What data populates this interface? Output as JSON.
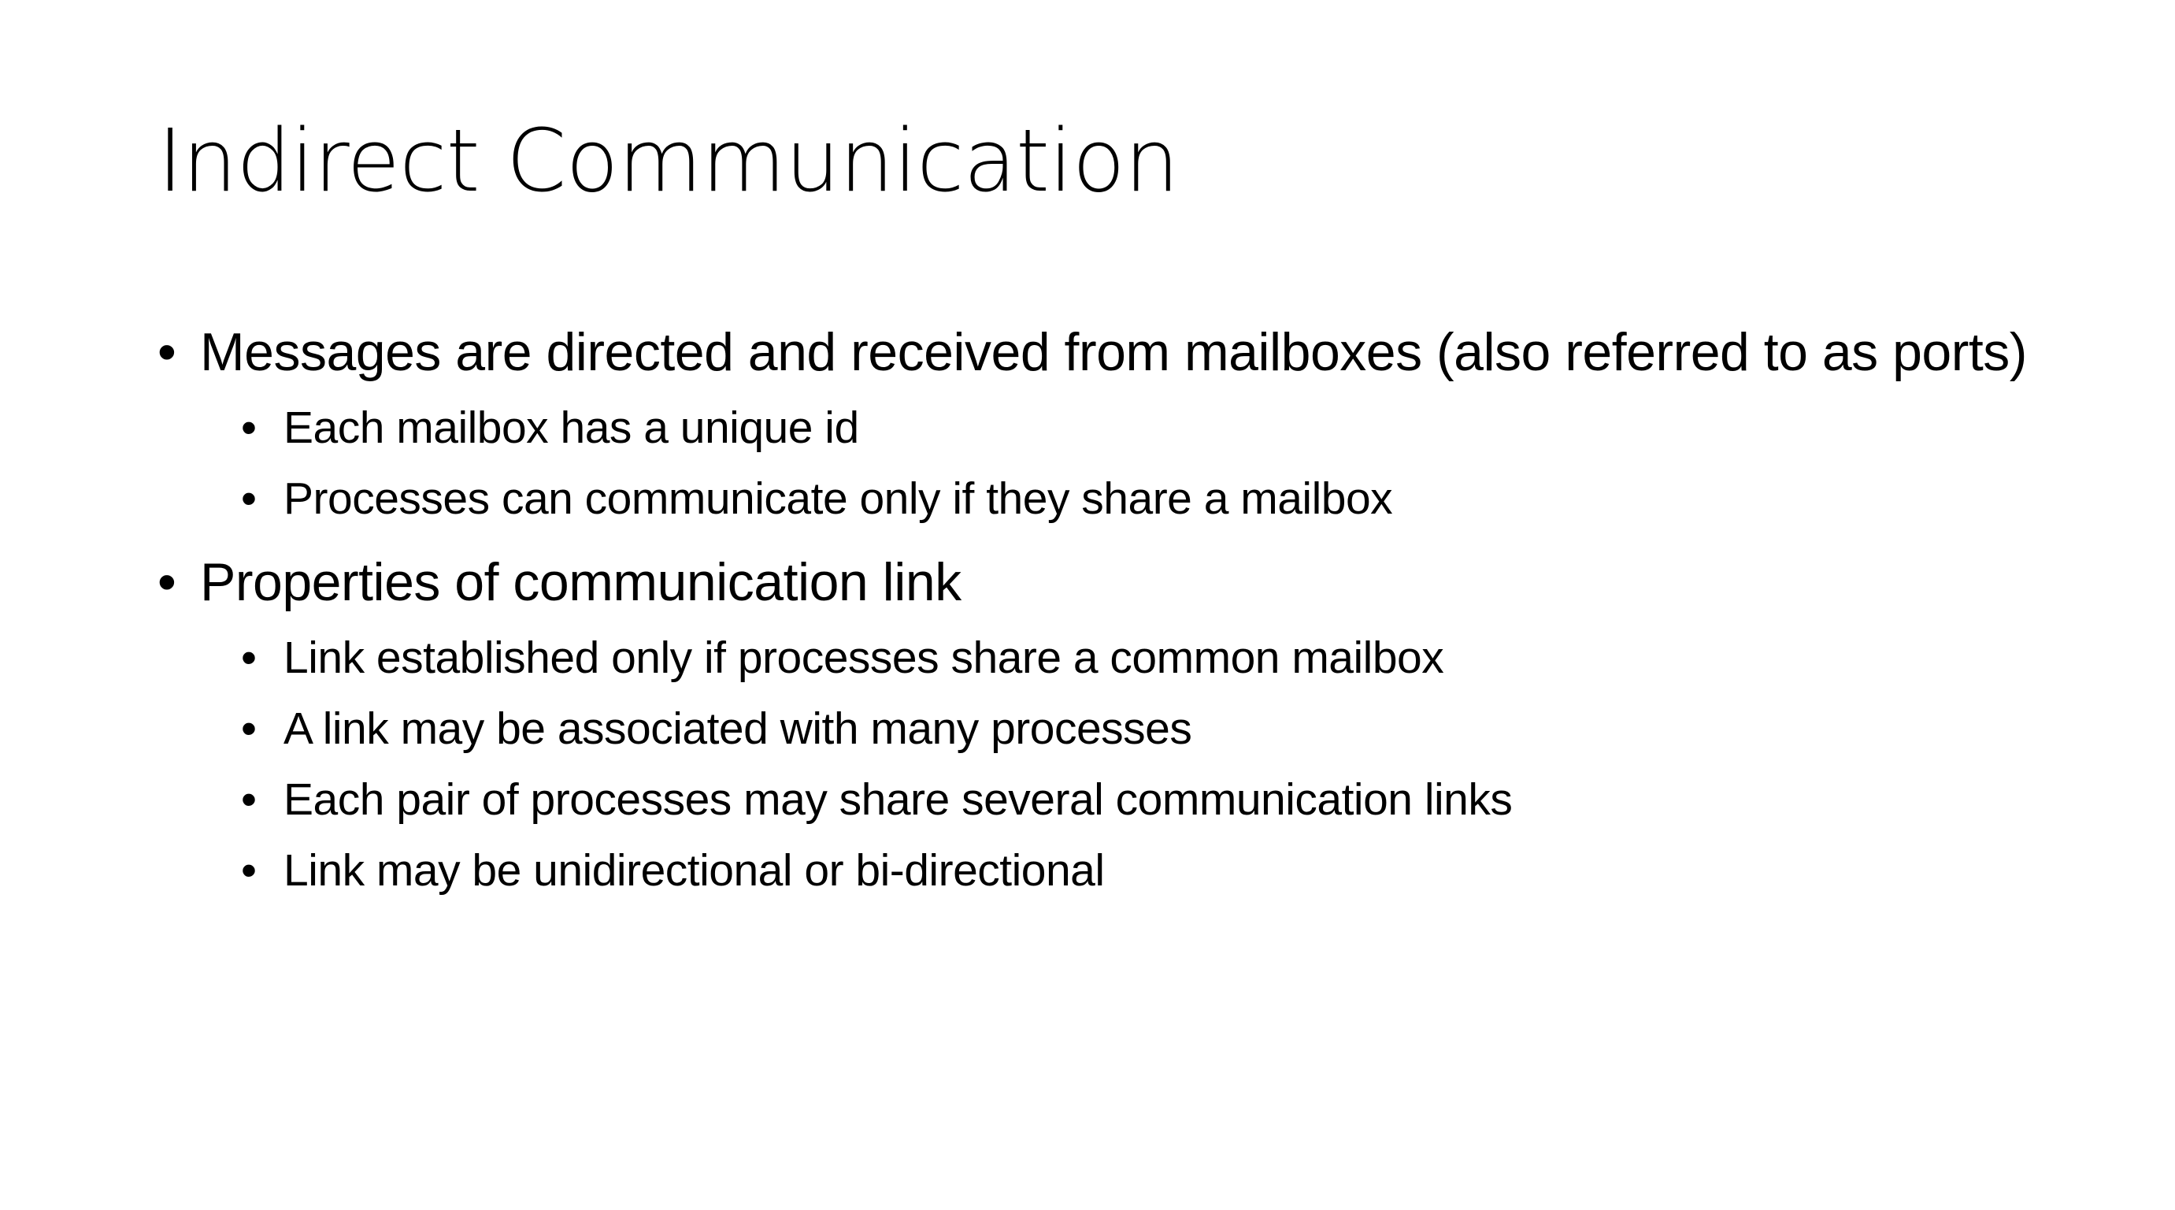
{
  "slide": {
    "title": "Indirect Communication",
    "bullet_glyph": "•",
    "bullets": [
      {
        "text": "Messages are directed and received from mailboxes (also referred to as ports)",
        "sub": [
          "Each mailbox has a unique id",
          "Processes can communicate only if they share a mailbox"
        ]
      },
      {
        "text": "Properties of communication link",
        "sub": [
          "Link established only if processes share a common mailbox",
          "A link may be associated with many processes",
          "Each pair of processes may share several communication links",
          "Link may be unidirectional or bi-directional"
        ]
      }
    ]
  }
}
